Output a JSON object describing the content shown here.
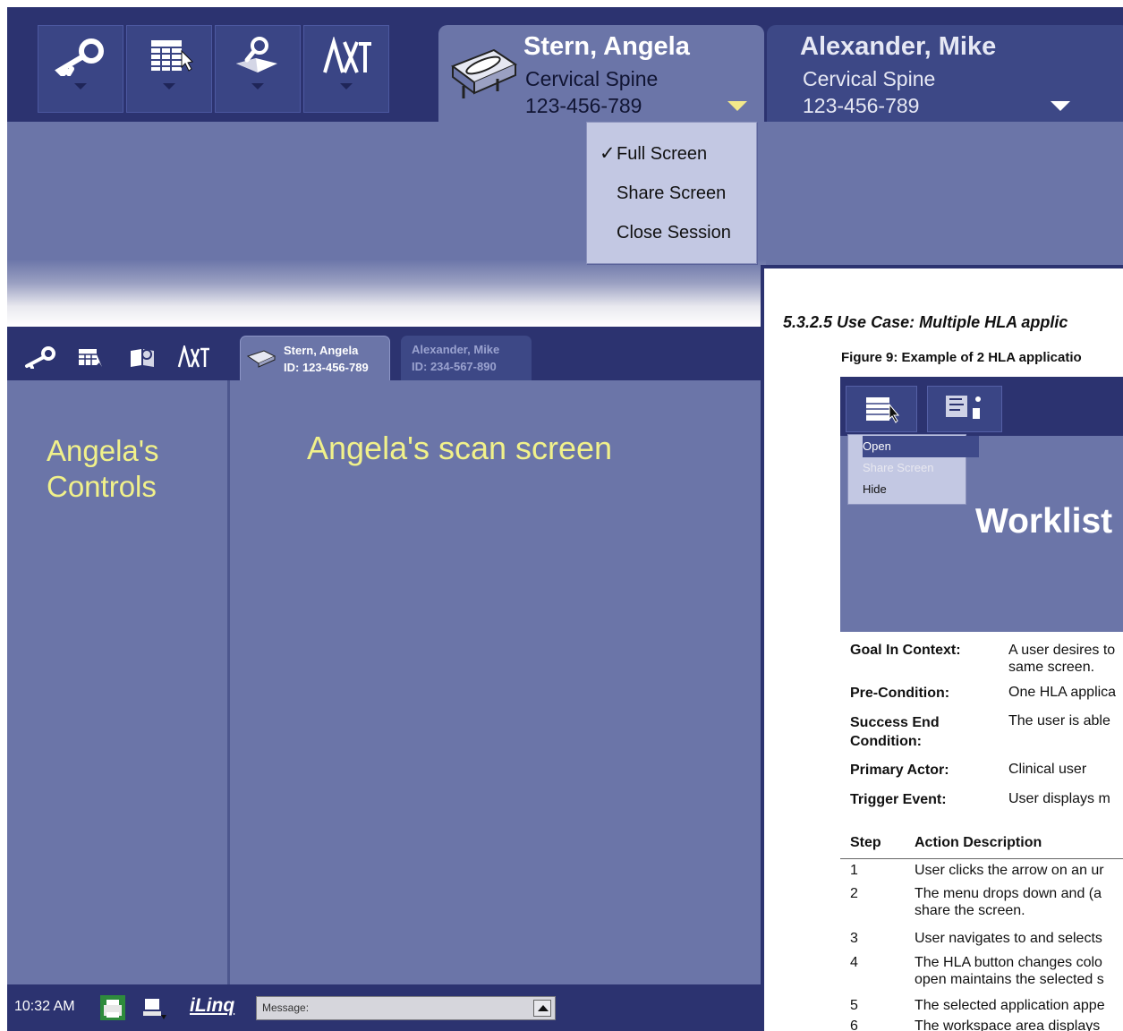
{
  "top_ui": {
    "toolbar": [
      {
        "name": "key-icon"
      },
      {
        "name": "worklist-icon"
      },
      {
        "name": "search-book-icon"
      },
      {
        "name": "tools-icon"
      }
    ],
    "tabs": [
      {
        "patient": "Stern, Angela",
        "study": "Cervical Spine",
        "id": "123-456-789",
        "active": true
      },
      {
        "patient": "Alexander, Mike",
        "study": "Cervical Spine",
        "id": "123-456-789",
        "active": false
      }
    ],
    "menu": {
      "items": [
        {
          "label": "Full Screen",
          "checked": true
        },
        {
          "label": "Share Screen",
          "checked": false
        },
        {
          "label": "Close Session",
          "checked": false
        }
      ],
      "check_mark": "✓"
    }
  },
  "small_ui": {
    "tabs": [
      {
        "patient": "Stern, Angela",
        "id": "ID: 123-456-789"
      },
      {
        "patient": "Alexander, Mike",
        "id": "ID: 234-567-890"
      }
    ],
    "left_panel_label": "Angela's\nControls",
    "scan_label": "Angela's scan screen",
    "taskbar": {
      "time": "10:32 AM",
      "brand": "iLinq",
      "message_placeholder": "Message:"
    }
  },
  "document": {
    "heading": "5.3.2.5  Use Case:  Multiple HLA applic",
    "figure_caption": "Figure 9: Example of 2 HLA applicatio",
    "figure": {
      "menu": [
        "Open",
        "Share Screen",
        "Hide"
      ],
      "title": "Worklist"
    },
    "fields": [
      {
        "label": "Goal In Context:",
        "value": "A user desires to\nsame screen."
      },
      {
        "label": "Pre-Condition:",
        "value": "One HLA applica"
      },
      {
        "label": "Success End\nCondition:",
        "value": "The user is able"
      },
      {
        "label": "Primary Actor:",
        "value": "Clinical user"
      },
      {
        "label": "Trigger Event:",
        "value": "User displays m"
      }
    ],
    "steps_header": {
      "step": "Step",
      "desc": "Action Description"
    },
    "steps": [
      {
        "n": "1",
        "text": "User clicks the arrow on an ur"
      },
      {
        "n": "2",
        "text": "The menu drops down and (a\nshare the screen."
      },
      {
        "n": "3",
        "text": "User navigates to and selects"
      },
      {
        "n": "4",
        "text": "The HLA button changes colo\nopen maintains the selected s"
      },
      {
        "n": "5",
        "text": "The selected application appe"
      },
      {
        "n": "6",
        "text": "The workspace area displays"
      }
    ]
  },
  "colors": {
    "dark_navy": "#2c3370",
    "panel_blue": "#6b75a8",
    "yellow_text": "#f1f18a",
    "menu_bg": "#c3c8e3"
  }
}
